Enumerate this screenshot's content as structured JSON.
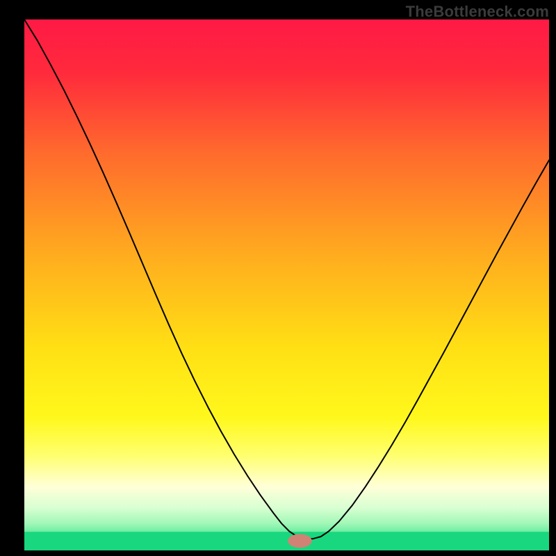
{
  "attribution": "TheBottleneck.com",
  "chart_data": {
    "type": "line",
    "title": "",
    "xlabel": "",
    "ylabel": "",
    "xlim": [
      0,
      100
    ],
    "ylim": [
      0,
      100
    ],
    "grid": false,
    "legend": false,
    "background_gradient": {
      "stops": [
        {
          "offset": 0.0,
          "color": "#ff1a45"
        },
        {
          "offset": 0.1,
          "color": "#ff2a3c"
        },
        {
          "offset": 0.25,
          "color": "#ff6a2d"
        },
        {
          "offset": 0.45,
          "color": "#ffae1e"
        },
        {
          "offset": 0.62,
          "color": "#ffe014"
        },
        {
          "offset": 0.75,
          "color": "#fff81c"
        },
        {
          "offset": 0.82,
          "color": "#ffff6d"
        },
        {
          "offset": 0.88,
          "color": "#ffffd8"
        },
        {
          "offset": 0.92,
          "color": "#d8ffd2"
        },
        {
          "offset": 0.95,
          "color": "#9ff7b6"
        },
        {
          "offset": 0.975,
          "color": "#4be693"
        },
        {
          "offset": 1.0,
          "color": "#19d77f"
        }
      ]
    },
    "green_band": {
      "y0": 0,
      "y1": 3.5,
      "color": "#19d77f"
    },
    "marker": {
      "x": 52.5,
      "y": 1.8,
      "rx": 2.3,
      "ry": 1.3,
      "color": "#d08275"
    },
    "series": [
      {
        "name": "bottleneck-curve",
        "color": "#000000",
        "stroke_width": 2,
        "x": [
          0.0,
          2.5,
          5.0,
          7.5,
          10.0,
          12.5,
          15.0,
          17.5,
          20.0,
          22.5,
          25.0,
          27.5,
          30.0,
          32.5,
          35.0,
          37.5,
          40.0,
          42.5,
          45.0,
          47.5,
          49.0,
          50.5,
          52.0,
          53.5,
          55.0,
          56.5,
          58.0,
          60.0,
          62.5,
          65.0,
          67.5,
          70.0,
          72.5,
          75.0,
          77.5,
          80.0,
          82.5,
          85.0,
          87.5,
          90.0,
          92.5,
          95.0,
          97.5,
          100.0
        ],
        "y": [
          100.0,
          96.0,
          91.5,
          86.8,
          81.8,
          76.6,
          71.2,
          65.6,
          59.9,
          54.1,
          48.3,
          42.6,
          37.1,
          31.9,
          27.0,
          22.4,
          18.1,
          14.1,
          10.4,
          7.0,
          5.1,
          3.6,
          2.6,
          2.2,
          2.2,
          2.6,
          3.6,
          5.5,
          8.5,
          12.0,
          15.8,
          19.8,
          24.0,
          28.4,
          32.9,
          37.4,
          42.0,
          46.6,
          51.2,
          55.8,
          60.3,
          64.8,
          69.2,
          73.5
        ]
      }
    ]
  }
}
